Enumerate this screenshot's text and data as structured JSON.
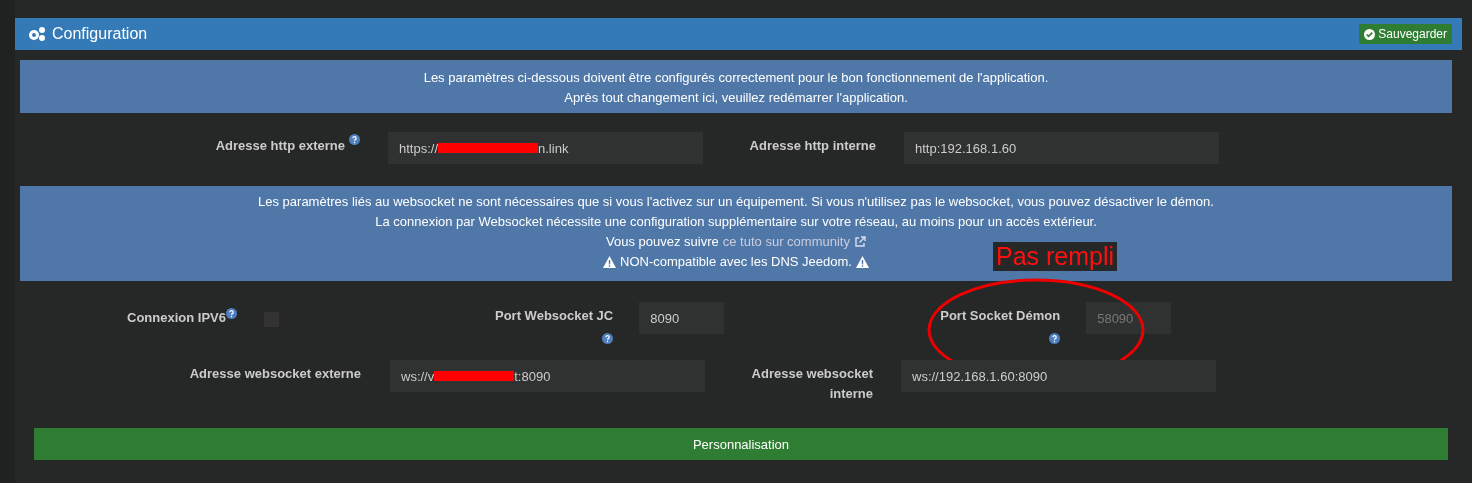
{
  "panel": {
    "title": "Configuration",
    "save_button": "Sauvegarder"
  },
  "intro_alert": [
    "Les paramètres ci-dessous doivent être configurés correctement pour le bon fonctionnement de l'application.",
    "Après tout changement ici, veuillez redémarrer l'application."
  ],
  "http_fields": [
    {
      "label": "Adresse http externe",
      "help": true,
      "value_start": "https://",
      "value_end": "n.link",
      "redacted": true
    },
    {
      "label": "Adresse http interne",
      "help": false,
      "value_start": "http:192.168.1.60",
      "redacted": false
    }
  ],
  "websocket_alert": {
    "lines": [
      "Les paramètres liés au websocket ne sont nécessaires que si vous l'activez sur un équipement. Si vous n'utilisez pas le websocket, vous pouvez désactiver le démon.",
      "La connexion par Websocket nécessite une configuration supplémentaire sur votre réseau, au moins pour un accès extérieur."
    ],
    "tuto_prefix": "Vous pouvez suivre",
    "tuto_link": "ce tuto sur community",
    "warning": "NON-compatible avec les DNS Jeedom."
  },
  "ipv6": {
    "label": "Connexion IPV6",
    "checked": false
  },
  "port_jc": {
    "label": "Port Websocket JC",
    "value": "8090"
  },
  "port_demon": {
    "label": "Port Socket Démon",
    "placeholder": "58090"
  },
  "ws_fields": [
    {
      "label": "Adresse websocket externe",
      "value_start": "ws://v",
      "value_end": "t:8090",
      "redacted": true
    },
    {
      "label": "Adresse websocket interne",
      "value_start": "ws://192.168.1.60:8090",
      "redacted": false
    }
  ],
  "section_bar": "Personnalisation",
  "annotation": "Pas rempli"
}
